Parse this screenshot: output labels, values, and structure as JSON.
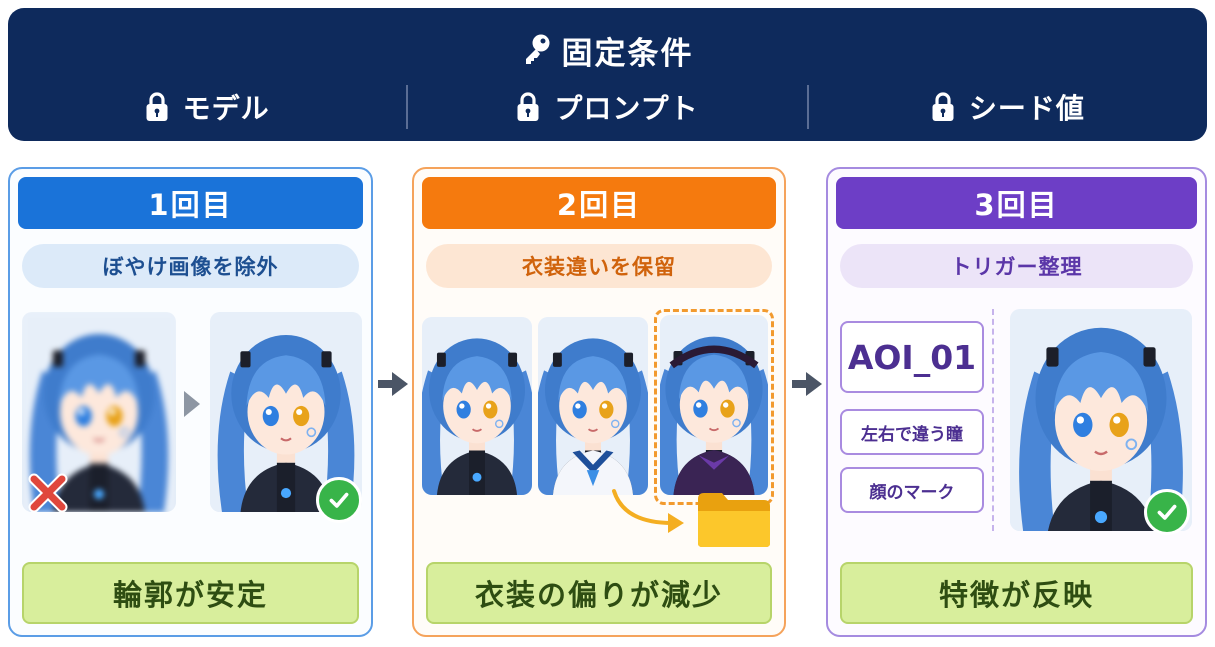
{
  "header": {
    "title": "固定条件",
    "conditions": [
      "モデル",
      "プロンプト",
      "シード値"
    ]
  },
  "panels": [
    {
      "round": "1回目",
      "subtitle": "ぼやけ画像を除外",
      "result": "輪郭が安定"
    },
    {
      "round": "2回目",
      "subtitle": "衣装違いを保留",
      "result": "衣装の偏りが減少"
    },
    {
      "round": "3回目",
      "subtitle": "トリガー整理",
      "trigger_word": "AOI_01",
      "features": [
        "左右で違う瞳",
        "顔のマーク"
      ],
      "result": "特徴が反映"
    }
  ],
  "icons": [
    "key-icon",
    "lock-icon",
    "check-icon",
    "x-icon",
    "folder-icon",
    "arrow-icon"
  ],
  "colors": {
    "header_bg": "#0e2a5c",
    "round1": "#1a73d9",
    "round2": "#f57a0e",
    "round3": "#6d3ec6",
    "result_bg": "#d8ee9c",
    "check": "#38b449",
    "reject": "#e0473c"
  }
}
